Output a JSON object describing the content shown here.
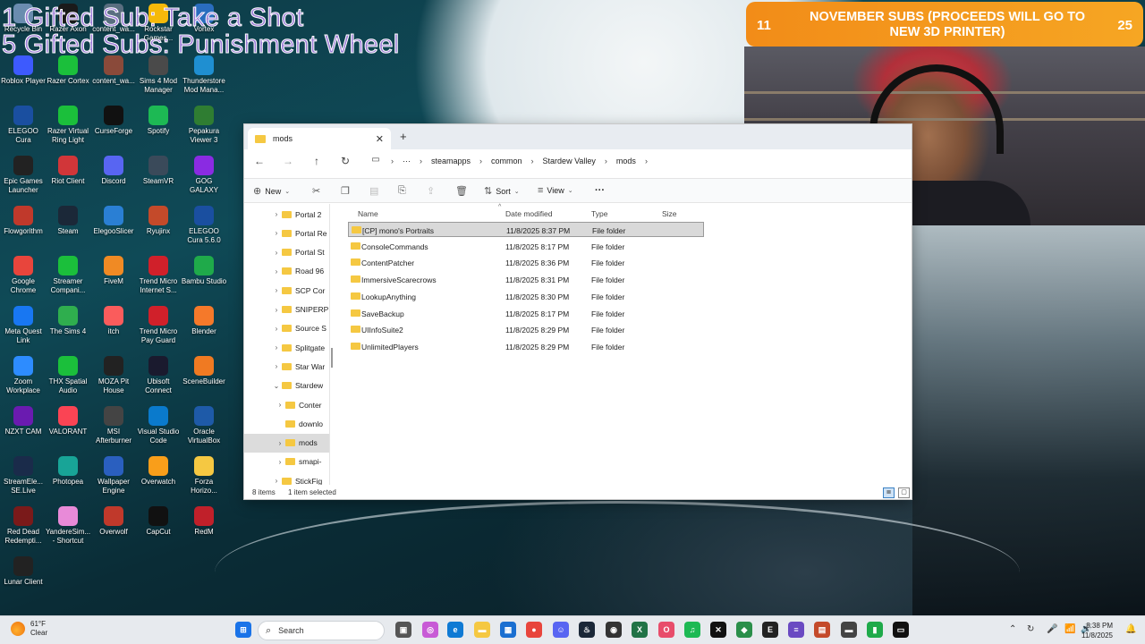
{
  "overlay": {
    "line1": "1 Gifted Sub: Take a Shot",
    "line2": "5 Gifted Subs: Punishment Wheel"
  },
  "banner": {
    "left_count": "11",
    "message": "NOVEMBER SUBS (PROCEEDS WILL GO TO NEW 3D PRINTER)",
    "right_count": "25",
    "color": "#f28c18"
  },
  "desktop_icons": [
    {
      "label": "Recycle Bin",
      "icon": "recycle-bin-icon",
      "color": "#6a8caf"
    },
    {
      "label": "Razer Axon",
      "icon": "razer-icon",
      "color": "#1a1a1a"
    },
    {
      "label": "content_wa...",
      "icon": "file-icon",
      "color": "#5a6e80"
    },
    {
      "label": "Rockstar Games...",
      "icon": "rockstar-icon",
      "color": "#f5b90a"
    },
    {
      "label": "Vortex",
      "icon": "vortex-icon",
      "color": "#2a6dbf"
    },
    {
      "label": "Roblox Player",
      "icon": "roblox-icon",
      "color": "#3d5afe"
    },
    {
      "label": "Razer Cortex",
      "icon": "razer-cortex-icon",
      "color": "#1bbf3b"
    },
    {
      "label": "content_wa...",
      "icon": "file-icon",
      "color": "#8a4a3a"
    },
    {
      "label": "Sims 4 Mod Manager",
      "icon": "sims-mod-icon",
      "color": "#4a4a4a"
    },
    {
      "label": "Thunderstore Mod Mana...",
      "icon": "thunderstore-icon",
      "color": "#1f8fd1"
    },
    {
      "label": "ELEGOO Cura",
      "icon": "cura-icon",
      "color": "#1a4fa0"
    },
    {
      "label": "Razer Virtual Ring Light",
      "icon": "ring-light-icon",
      "color": "#1bbf3b"
    },
    {
      "label": "CurseForge",
      "icon": "curseforge-icon",
      "color": "#111111"
    },
    {
      "label": "Spotify",
      "icon": "spotify-icon",
      "color": "#1db954"
    },
    {
      "label": "Pepakura Viewer 3",
      "icon": "pepakura-icon",
      "color": "#2f7d32"
    },
    {
      "label": "Epic Games Launcher",
      "icon": "epic-icon",
      "color": "#222222"
    },
    {
      "label": "Riot Client",
      "icon": "riot-icon",
      "color": "#d13639"
    },
    {
      "label": "Discord",
      "icon": "discord-icon",
      "color": "#5865f2"
    },
    {
      "label": "SteamVR",
      "icon": "steamvr-icon",
      "color": "#3a4a5a"
    },
    {
      "label": "GOG GALAXY",
      "icon": "gog-icon",
      "color": "#8a2be2"
    },
    {
      "label": "Flowgorithm",
      "icon": "flowgorithm-icon",
      "color": "#c0392b"
    },
    {
      "label": "Steam",
      "icon": "steam-icon",
      "color": "#1b2838"
    },
    {
      "label": "ElegooSlicer",
      "icon": "slicer-icon",
      "color": "#2a7fd4"
    },
    {
      "label": "Ryujinx",
      "icon": "ryujinx-icon",
      "color": "#c44a2a"
    },
    {
      "label": "ELEGOO Cura 5.6.0",
      "icon": "cura-icon",
      "color": "#1a4fa0"
    },
    {
      "label": "Google Chrome",
      "icon": "chrome-icon",
      "color": "#e8453c"
    },
    {
      "label": "Streamer Compani...",
      "icon": "streamer-companion-icon",
      "color": "#1bbf3b"
    },
    {
      "label": "FiveM",
      "icon": "fivem-icon",
      "color": "#f08a24"
    },
    {
      "label": "Trend Micro Internet S...",
      "icon": "trend-micro-icon",
      "color": "#d0202a"
    },
    {
      "label": "Bambu Studio",
      "icon": "bambu-icon",
      "color": "#1faa4a"
    },
    {
      "label": "Meta Quest Link",
      "icon": "meta-icon",
      "color": "#1877f2"
    },
    {
      "label": "The Sims 4",
      "icon": "sims4-icon",
      "color": "#2fae4e"
    },
    {
      "label": "itch",
      "icon": "itch-icon",
      "color": "#fa5c5c"
    },
    {
      "label": "Trend Micro Pay Guard",
      "icon": "trend-micro-icon",
      "color": "#d0202a"
    },
    {
      "label": "Blender",
      "icon": "blender-icon",
      "color": "#f5792a"
    },
    {
      "label": "Zoom Workplace",
      "icon": "zoom-icon",
      "color": "#2d8cff"
    },
    {
      "label": "THX Spatial Audio",
      "icon": "thx-icon",
      "color": "#1bbf3b"
    },
    {
      "label": "MOZA Pit House",
      "icon": "moza-icon",
      "color": "#222222"
    },
    {
      "label": "Ubisoft Connect",
      "icon": "ubisoft-icon",
      "color": "#1a1a2e"
    },
    {
      "label": "SceneBuilder",
      "icon": "scenebuilder-icon",
      "color": "#f07a22"
    },
    {
      "label": "NZXT CAM",
      "icon": "nzxt-icon",
      "color": "#6a1bb0"
    },
    {
      "label": "VALORANT",
      "icon": "valorant-icon",
      "color": "#fa4454"
    },
    {
      "label": "MSI Afterburner",
      "icon": "msi-icon",
      "color": "#444444"
    },
    {
      "label": "Visual Studio Code",
      "icon": "vscode-icon",
      "color": "#0a7acc"
    },
    {
      "label": "Oracle VirtualBox",
      "icon": "virtualbox-icon",
      "color": "#1e5aa8"
    },
    {
      "label": "StreamEle... SE.Live",
      "icon": "streamelements-icon",
      "color": "#1a2b4a"
    },
    {
      "label": "Photopea",
      "icon": "photopea-icon",
      "color": "#18a497"
    },
    {
      "label": "Wallpaper Engine",
      "icon": "wallpaper-engine-icon",
      "color": "#2a5fbf"
    },
    {
      "label": "Overwatch",
      "icon": "overwatch-icon",
      "color": "#f99e1a"
    },
    {
      "label": "Forza Horizo...",
      "icon": "folder-icon",
      "color": "#f5c842"
    },
    {
      "label": "Red Dead Redempti...",
      "icon": "rdr-icon",
      "color": "#7a1a1a"
    },
    {
      "label": "YandereSim... - Shortcut",
      "icon": "yandere-icon",
      "color": "#e88ad8"
    },
    {
      "label": "Overwolf",
      "icon": "overwolf-icon",
      "color": "#c0392b"
    },
    {
      "label": "CapCut",
      "icon": "capcut-icon",
      "color": "#111111"
    },
    {
      "label": "RedM",
      "icon": "redm-icon",
      "color": "#c0202a"
    },
    {
      "label": "Lunar Client",
      "icon": "lunar-icon",
      "color": "#222222"
    }
  ],
  "explorer": {
    "tab_title": "mods",
    "breadcrumbs": [
      "steamapps",
      "common",
      "Stardew Valley",
      "mods"
    ],
    "toolbar": {
      "new_label": "New",
      "sort_label": "Sort",
      "view_label": "View",
      "more_label": "···"
    },
    "nav_items": [
      {
        "label": "Portal 2",
        "chev": "›"
      },
      {
        "label": "Portal Re",
        "chev": "›"
      },
      {
        "label": "Portal St",
        "chev": "›"
      },
      {
        "label": "Road 96",
        "chev": "›"
      },
      {
        "label": "SCP Cor",
        "chev": "›"
      },
      {
        "label": "SNIPERP",
        "chev": "›"
      },
      {
        "label": "Source S",
        "chev": "›"
      },
      {
        "label": "Splitgate",
        "chev": "›"
      },
      {
        "label": "Star War",
        "chev": "›"
      },
      {
        "label": "Stardew",
        "chev": "⌄"
      },
      {
        "label": "Conter",
        "chev": "›"
      },
      {
        "label": "downlo",
        "chev": ""
      },
      {
        "label": "mods",
        "chev": "›"
      },
      {
        "label": "smapi-",
        "chev": "›"
      },
      {
        "label": "StickFig",
        "chev": "›"
      }
    ],
    "columns": {
      "name": "Name",
      "date": "Date modified",
      "type": "Type",
      "size": "Size"
    },
    "files": [
      {
        "name": "[CP] mono's Portraits",
        "date": "11/8/2025 8:37 PM",
        "type": "File folder"
      },
      {
        "name": "ConsoleCommands",
        "date": "11/8/2025 8:17 PM",
        "type": "File folder"
      },
      {
        "name": "ContentPatcher",
        "date": "11/8/2025 8:36 PM",
        "type": "File folder"
      },
      {
        "name": "ImmersiveScarecrows",
        "date": "11/8/2025 8:31 PM",
        "type": "File folder"
      },
      {
        "name": "LookupAnything",
        "date": "11/8/2025 8:30 PM",
        "type": "File folder"
      },
      {
        "name": "SaveBackup",
        "date": "11/8/2025 8:17 PM",
        "type": "File folder"
      },
      {
        "name": "UIInfoSuite2",
        "date": "11/8/2025 8:29 PM",
        "type": "File folder"
      },
      {
        "name": "UnlimitedPlayers",
        "date": "11/8/2025 8:29 PM",
        "type": "File folder"
      }
    ],
    "status": {
      "items": "8 items",
      "selected": "1 item selected"
    }
  },
  "taskbar": {
    "weather_temp": "61°F",
    "weather_desc": "Clear",
    "search_placeholder": "Search",
    "time": "8:38 PM",
    "date": "11/8/2025"
  }
}
